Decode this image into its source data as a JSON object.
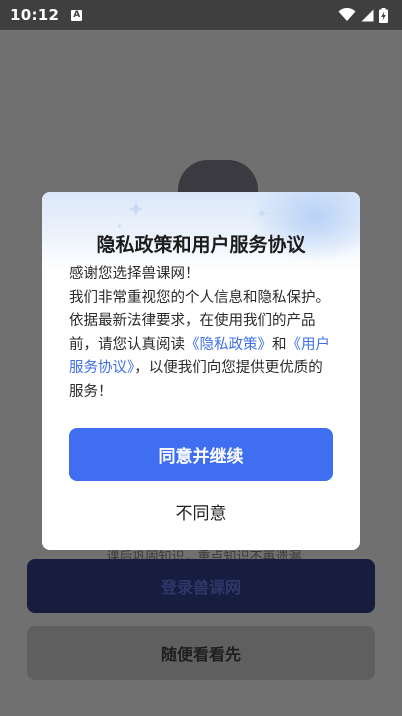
{
  "status_bar": {
    "time": "10:12",
    "notification_icon": "A",
    "icons": [
      "wifi-icon",
      "signal-icon",
      "battery-charging-icon"
    ]
  },
  "background": {
    "subtext": "课后巩固知识，重点知识不再遗漏",
    "login_button": "登录兽课网",
    "browse_button": "随便看看先"
  },
  "dialog": {
    "title": "隐私政策和用户服务协议",
    "body": {
      "greeting": "感谢您选择兽课网！",
      "intro": "我们非常重视您的个人信息和隐私保护。依据最新法律要求，在使用我们的产品前，请您认真阅读",
      "privacy_link": "《隐私政策》",
      "conjunction": "和",
      "service_link": "《用户服务协议》",
      "outro": "，以便我们向您提供更优质的服务！"
    },
    "agree_button": "同意并继续",
    "disagree_button": "不同意"
  },
  "colors": {
    "primary": "#3f6ff0",
    "link": "#3f6fe8",
    "overlay": "#707070"
  }
}
